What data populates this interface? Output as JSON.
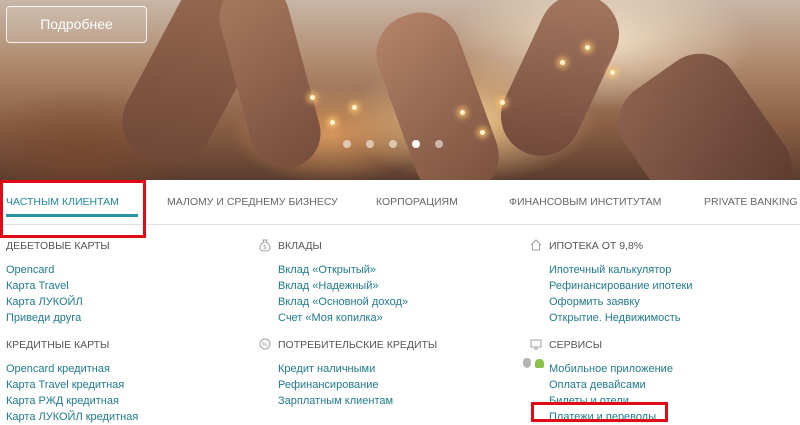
{
  "hero": {
    "button_label": "Подробнее",
    "slides": 5,
    "active_slide": 4
  },
  "tabs": [
    {
      "label": "ЧАСТНЫМ КЛИЕНТАМ",
      "active": true
    },
    {
      "label": "МАЛОМУ И СРЕДНЕМУ БИЗНЕСУ",
      "active": false
    },
    {
      "label": "КОРПОРАЦИЯМ",
      "active": false
    },
    {
      "label": "ФИНАНСОВЫМ ИНСТИТУТАМ",
      "active": false
    },
    {
      "label": "PRIVATE BANKING",
      "active": false
    }
  ],
  "sections": {
    "debit": {
      "title": "ДЕБЕТОВЫЕ КАРТЫ",
      "items": [
        "Opencard",
        "Карта Travel",
        "Карта ЛУКОЙЛ",
        "Приведи друга"
      ]
    },
    "deposits": {
      "title": "ВКЛАДЫ",
      "icon": "money-bag-icon",
      "items": [
        "Вклад «Открытый»",
        "Вклад «Надежный»",
        "Вклад «Основной доход»",
        "Счет «Моя копилка»"
      ]
    },
    "mortgage": {
      "title": "ИПОТЕКА ОТ 9,8%",
      "icon": "house-icon",
      "items": [
        "Ипотечный калькулятор",
        "Рефинансирование ипотеки",
        "Оформить заявку",
        "Открытие. Недвижимость"
      ]
    },
    "credit": {
      "title": "КРЕДИТНЫЕ КАРТЫ",
      "items": [
        "Opencard кредитная",
        "Карта Travel кредитная",
        "Карта РЖД кредитная",
        "Карта ЛУКОЙЛ кредитная"
      ]
    },
    "loans": {
      "title": "ПОТРЕБИТЕЛЬСКИЕ КРЕДИТЫ",
      "icon": "percent-icon",
      "items": [
        "Кредит наличными",
        "Рефинансирование",
        "Зарплатным клиентам"
      ]
    },
    "services": {
      "title": "СЕРВИСЫ",
      "icon": "monitor-icon",
      "items": [
        "Мобильное приложение",
        "Оплата девайсами",
        "Билеты и отели",
        "Платежи и переводы"
      ]
    }
  },
  "colors": {
    "accent": "#1f7b8c",
    "highlight": "#e20a17"
  }
}
